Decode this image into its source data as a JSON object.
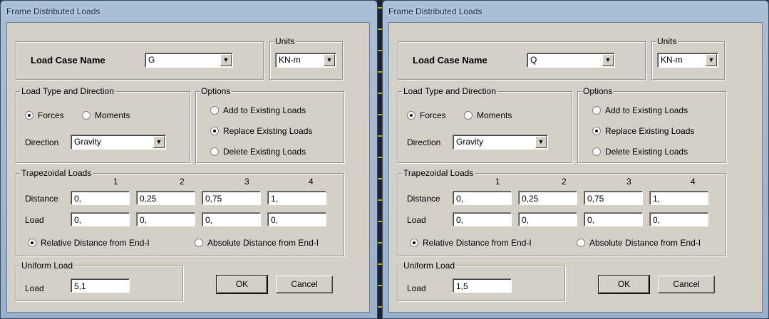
{
  "dialogs": [
    {
      "title": "Frame Distributed Loads",
      "load_case_label": "Load Case Name",
      "load_case_value": "G",
      "units_label": "Units",
      "units_value": "KN-m",
      "load_type_group": "Load Type and Direction",
      "forces_label": "Forces",
      "moments_label": "Moments",
      "direction_label": "Direction",
      "direction_value": "Gravity",
      "options_group": "Options",
      "options": [
        "Add to Existing Loads",
        "Replace Existing Loads",
        "Delete Existing Loads"
      ],
      "options_selected": 1,
      "trap_group": "Trapezoidal Loads",
      "columns": [
        "1",
        "2",
        "3",
        "4"
      ],
      "distance_label": "Distance",
      "distances": [
        "0,",
        "0,25",
        "0,75",
        "1,"
      ],
      "load_label": "Load",
      "loads": [
        "0,",
        "0,",
        "0,",
        "0,"
      ],
      "relative_label": "Relative Distance from End-I",
      "absolute_label": "Absolute Distance from End-I",
      "uniform_group": "Uniform Load",
      "uniform_load_label": "Load",
      "uniform_load_value": "5,1",
      "ok_label": "OK",
      "cancel_label": "Cancel"
    },
    {
      "title": "Frame Distributed Loads",
      "load_case_label": "Load Case Name",
      "load_case_value": "Q",
      "units_label": "Units",
      "units_value": "KN-m",
      "load_type_group": "Load Type and Direction",
      "forces_label": "Forces",
      "moments_label": "Moments",
      "direction_label": "Direction",
      "direction_value": "Gravity",
      "options_group": "Options",
      "options": [
        "Add to Existing Loads",
        "Replace Existing Loads",
        "Delete Existing Loads"
      ],
      "options_selected": 1,
      "trap_group": "Trapezoidal Loads",
      "columns": [
        "1",
        "2",
        "3",
        "4"
      ],
      "distance_label": "Distance",
      "distances": [
        "0,",
        "0,25",
        "0,75",
        "1,"
      ],
      "load_label": "Load",
      "loads": [
        "0,",
        "0,",
        "0,",
        "0,"
      ],
      "relative_label": "Relative Distance from End-I",
      "absolute_label": "Absolute Distance from End-I",
      "uniform_group": "Uniform Load",
      "uniform_load_label": "Load",
      "uniform_load_value": "1,5",
      "ok_label": "OK",
      "cancel_label": "Cancel"
    }
  ]
}
